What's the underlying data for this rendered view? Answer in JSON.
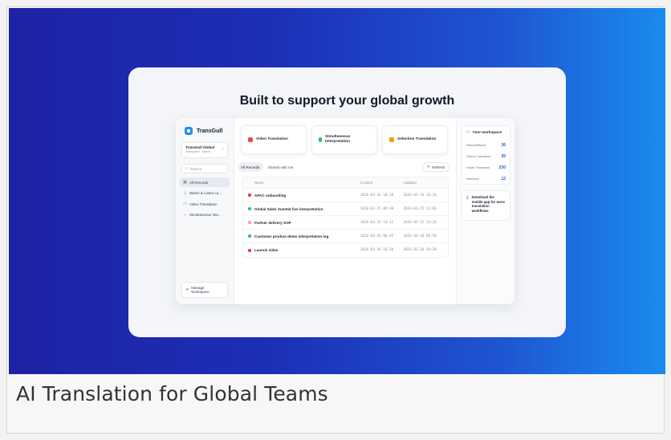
{
  "headline": "Built to support your global growth",
  "caption": "AI Translation for Global Teams",
  "colors": {
    "accent": "#1f8ef1",
    "gradient_start": "#1e22a4",
    "gradient_end": "#1a8bee",
    "video": "#ef4444",
    "interpretation": "#22c55e",
    "selection": "#f59e0b",
    "document": "#f87171"
  },
  "sidebar": {
    "brand": "TransGull",
    "workspace_name": "TransGull Global",
    "workspace_role": "Workspace · Admin",
    "search_placeholder": "Search",
    "items": [
      {
        "label": "All Records",
        "icon": "grid-icon"
      },
      {
        "label": "Watch & Listen La...",
        "icon": "bookmark-icon"
      },
      {
        "label": "Video Translation",
        "icon": "video-icon"
      },
      {
        "label": "Simultaneous Inte...",
        "icon": "mic-icon"
      }
    ],
    "manage_label": "Manage Workspace"
  },
  "features": [
    {
      "label": "Video Translation",
      "icon": "video-icon"
    },
    {
      "label": "Simultaneous Interpretation",
      "icon": "mic-icon"
    },
    {
      "label": "Selection Translation",
      "icon": "selection-icon"
    }
  ],
  "tabs": {
    "all": "All Records",
    "shared": "Shared with me"
  },
  "refresh_label": "Refresh",
  "table": {
    "headers": {
      "name": "Name",
      "created": "Created",
      "updated": "Updated"
    },
    "rows": [
      {
        "name": "APAC onboarding",
        "type": "video",
        "created": "2026-03-24 10:28",
        "updated": "2026-03-24 10:28"
      },
      {
        "name": "Global Sales Summit live interpretation",
        "type": "interpretation",
        "created": "2026-03-25 09:30",
        "updated": "2026-03-25 11:06"
      },
      {
        "name": "Partner delivery SOP",
        "type": "document",
        "created": "2026-03-25 14:12",
        "updated": "2026-03-25 14:20"
      },
      {
        "name": "Customer product demo interpretation log",
        "type": "interpretation",
        "created": "2026-03-26 08:45",
        "updated": "2026-03-26 09:58"
      },
      {
        "name": "Launch video",
        "type": "video",
        "created": "2026-03-26 16:20",
        "updated": "2026-03-26 16:28"
      }
    ]
  },
  "workspace_panel": {
    "title": "Your workspace",
    "stats": [
      {
        "label": "Interpretations",
        "value": "36"
      },
      {
        "label": "Videos Translated",
        "value": "35"
      },
      {
        "label": "Hours Translated",
        "value": "230"
      },
      {
        "label": "Members",
        "value": "12"
      }
    ]
  },
  "download_text": "Download the mobile app for more translation workflows"
}
